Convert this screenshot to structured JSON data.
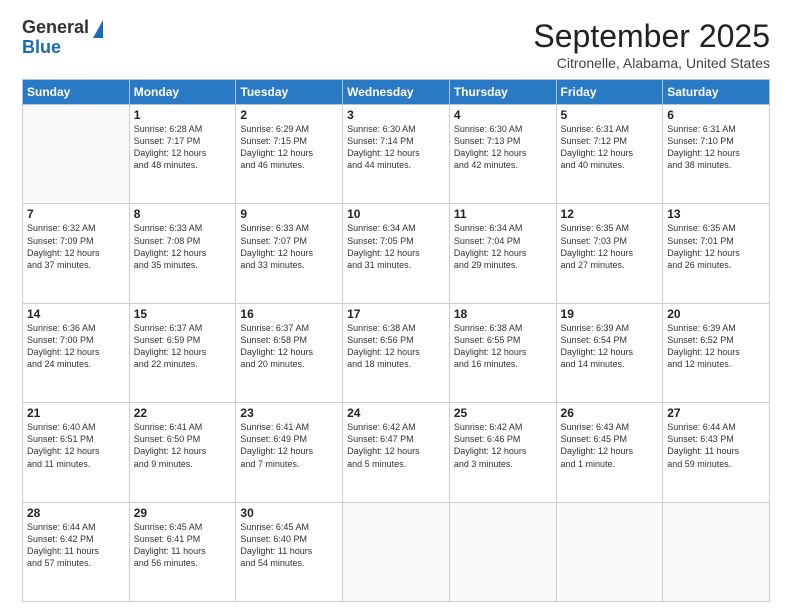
{
  "header": {
    "logo_general": "General",
    "logo_blue": "Blue",
    "month_title": "September 2025",
    "location": "Citronelle, Alabama, United States"
  },
  "weekdays": [
    "Sunday",
    "Monday",
    "Tuesday",
    "Wednesday",
    "Thursday",
    "Friday",
    "Saturday"
  ],
  "weeks": [
    [
      {
        "day": "",
        "info": ""
      },
      {
        "day": "1",
        "info": "Sunrise: 6:28 AM\nSunset: 7:17 PM\nDaylight: 12 hours\nand 48 minutes."
      },
      {
        "day": "2",
        "info": "Sunrise: 6:29 AM\nSunset: 7:15 PM\nDaylight: 12 hours\nand 46 minutes."
      },
      {
        "day": "3",
        "info": "Sunrise: 6:30 AM\nSunset: 7:14 PM\nDaylight: 12 hours\nand 44 minutes."
      },
      {
        "day": "4",
        "info": "Sunrise: 6:30 AM\nSunset: 7:13 PM\nDaylight: 12 hours\nand 42 minutes."
      },
      {
        "day": "5",
        "info": "Sunrise: 6:31 AM\nSunset: 7:12 PM\nDaylight: 12 hours\nand 40 minutes."
      },
      {
        "day": "6",
        "info": "Sunrise: 6:31 AM\nSunset: 7:10 PM\nDaylight: 12 hours\nand 38 minutes."
      }
    ],
    [
      {
        "day": "7",
        "info": "Sunrise: 6:32 AM\nSunset: 7:09 PM\nDaylight: 12 hours\nand 37 minutes."
      },
      {
        "day": "8",
        "info": "Sunrise: 6:33 AM\nSunset: 7:08 PM\nDaylight: 12 hours\nand 35 minutes."
      },
      {
        "day": "9",
        "info": "Sunrise: 6:33 AM\nSunset: 7:07 PM\nDaylight: 12 hours\nand 33 minutes."
      },
      {
        "day": "10",
        "info": "Sunrise: 6:34 AM\nSunset: 7:05 PM\nDaylight: 12 hours\nand 31 minutes."
      },
      {
        "day": "11",
        "info": "Sunrise: 6:34 AM\nSunset: 7:04 PM\nDaylight: 12 hours\nand 29 minutes."
      },
      {
        "day": "12",
        "info": "Sunrise: 6:35 AM\nSunset: 7:03 PM\nDaylight: 12 hours\nand 27 minutes."
      },
      {
        "day": "13",
        "info": "Sunrise: 6:35 AM\nSunset: 7:01 PM\nDaylight: 12 hours\nand 26 minutes."
      }
    ],
    [
      {
        "day": "14",
        "info": "Sunrise: 6:36 AM\nSunset: 7:00 PM\nDaylight: 12 hours\nand 24 minutes."
      },
      {
        "day": "15",
        "info": "Sunrise: 6:37 AM\nSunset: 6:59 PM\nDaylight: 12 hours\nand 22 minutes."
      },
      {
        "day": "16",
        "info": "Sunrise: 6:37 AM\nSunset: 6:58 PM\nDaylight: 12 hours\nand 20 minutes."
      },
      {
        "day": "17",
        "info": "Sunrise: 6:38 AM\nSunset: 6:56 PM\nDaylight: 12 hours\nand 18 minutes."
      },
      {
        "day": "18",
        "info": "Sunrise: 6:38 AM\nSunset: 6:55 PM\nDaylight: 12 hours\nand 16 minutes."
      },
      {
        "day": "19",
        "info": "Sunrise: 6:39 AM\nSunset: 6:54 PM\nDaylight: 12 hours\nand 14 minutes."
      },
      {
        "day": "20",
        "info": "Sunrise: 6:39 AM\nSunset: 6:52 PM\nDaylight: 12 hours\nand 12 minutes."
      }
    ],
    [
      {
        "day": "21",
        "info": "Sunrise: 6:40 AM\nSunset: 6:51 PM\nDaylight: 12 hours\nand 11 minutes."
      },
      {
        "day": "22",
        "info": "Sunrise: 6:41 AM\nSunset: 6:50 PM\nDaylight: 12 hours\nand 9 minutes."
      },
      {
        "day": "23",
        "info": "Sunrise: 6:41 AM\nSunset: 6:49 PM\nDaylight: 12 hours\nand 7 minutes."
      },
      {
        "day": "24",
        "info": "Sunrise: 6:42 AM\nSunset: 6:47 PM\nDaylight: 12 hours\nand 5 minutes."
      },
      {
        "day": "25",
        "info": "Sunrise: 6:42 AM\nSunset: 6:46 PM\nDaylight: 12 hours\nand 3 minutes."
      },
      {
        "day": "26",
        "info": "Sunrise: 6:43 AM\nSunset: 6:45 PM\nDaylight: 12 hours\nand 1 minute."
      },
      {
        "day": "27",
        "info": "Sunrise: 6:44 AM\nSunset: 6:43 PM\nDaylight: 11 hours\nand 59 minutes."
      }
    ],
    [
      {
        "day": "28",
        "info": "Sunrise: 6:44 AM\nSunset: 6:42 PM\nDaylight: 11 hours\nand 57 minutes."
      },
      {
        "day": "29",
        "info": "Sunrise: 6:45 AM\nSunset: 6:41 PM\nDaylight: 11 hours\nand 56 minutes."
      },
      {
        "day": "30",
        "info": "Sunrise: 6:45 AM\nSunset: 6:40 PM\nDaylight: 11 hours\nand 54 minutes."
      },
      {
        "day": "",
        "info": ""
      },
      {
        "day": "",
        "info": ""
      },
      {
        "day": "",
        "info": ""
      },
      {
        "day": "",
        "info": ""
      }
    ]
  ]
}
